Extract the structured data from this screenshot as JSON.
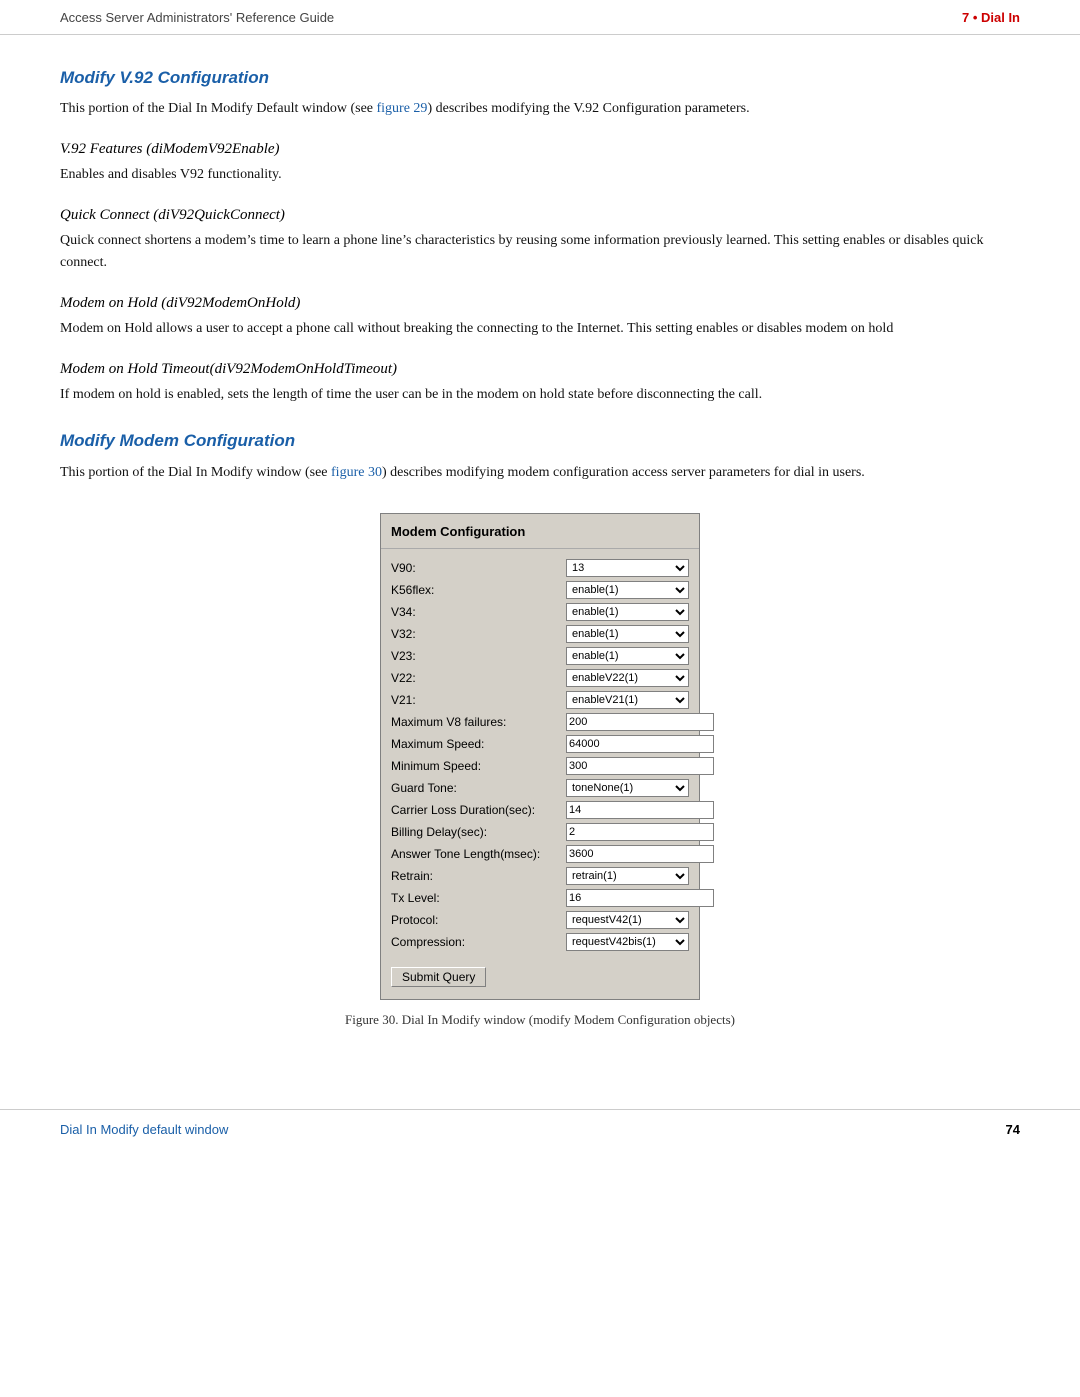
{
  "header": {
    "left": "Access Server Administrators' Reference Guide",
    "right": "7 • Dial In"
  },
  "sections": [
    {
      "id": "v92-config",
      "heading": "Modify V.92 Configuration",
      "intro": "This portion of the Dial In Modify Default window (see figure 29) describes modifying the V.92 Configuration parameters.",
      "intro_link": "figure 29",
      "subsections": [
        {
          "id": "v92-features",
          "title": "V.92 Features (diModemV92Enable)",
          "body": "Enables and disables V92 functionality."
        },
        {
          "id": "quick-connect",
          "title": "Quick Connect (diV92QuickConnect)",
          "body": "Quick connect shortens a modem’s time to learn a phone line’s characteristics by reusing some information previously learned. This setting enables or disables quick connect."
        },
        {
          "id": "modem-on-hold",
          "title": "Modem on Hold (diV92ModemOnHold)",
          "body": "Modem on Hold allows a user to accept a phone call without breaking the connecting to the Internet. This setting enables or disables modem on hold"
        },
        {
          "id": "modem-on-hold-timeout",
          "title": "Modem on Hold Timeout(diV92ModemOnHoldTimeout)",
          "body": "If modem on hold is enabled, sets the length of time the user can be in the modem on hold state before disconnecting the call."
        }
      ]
    },
    {
      "id": "modify-modem-config",
      "heading": "Modify Modem Configuration",
      "intro": "This portion of the Dial In Modify window (see figure 30) describes modifying modem configuration access server parameters for dial in users.",
      "intro_link": "figure 30"
    }
  ],
  "dialog": {
    "title": "Modem Configuration",
    "fields": [
      {
        "label": "V90:",
        "type": "select",
        "value": "13",
        "options": [
          "13"
        ]
      },
      {
        "label": "K56flex:",
        "type": "select",
        "value": "enable(1)",
        "options": [
          "enable(1)"
        ]
      },
      {
        "label": "V34:",
        "type": "select",
        "value": "enable(1)",
        "options": [
          "enable(1)"
        ]
      },
      {
        "label": "V32:",
        "type": "select",
        "value": "enable(1)",
        "options": [
          "enable(1)"
        ]
      },
      {
        "label": "V23:",
        "type": "select",
        "value": "enable(1)",
        "options": [
          "enable(1)"
        ]
      },
      {
        "label": "V22:",
        "type": "select",
        "value": "enableV22(1)",
        "options": [
          "enableV22(1)"
        ]
      },
      {
        "label": "V21:",
        "type": "select",
        "value": "enableV21(1)",
        "options": [
          "enableV21(1)"
        ]
      },
      {
        "label": "Maximum V8 failures:",
        "type": "input",
        "value": "200"
      },
      {
        "label": "Maximum Speed:",
        "type": "input",
        "value": "64000"
      },
      {
        "label": "Minimum Speed:",
        "type": "input",
        "value": "300"
      },
      {
        "label": "Guard Tone:",
        "type": "select",
        "value": "toneNone(1)",
        "options": [
          "toneNone(1)"
        ]
      },
      {
        "label": "Carrier Loss Duration(sec):",
        "type": "input",
        "value": "14"
      },
      {
        "label": "Billing Delay(sec):",
        "type": "input",
        "value": "2"
      },
      {
        "label": "Answer Tone Length(msec):",
        "type": "input",
        "value": "3600"
      },
      {
        "label": "Retrain:",
        "type": "select",
        "value": "retrain(1)",
        "options": [
          "retrain(1)"
        ]
      },
      {
        "label": "Tx Level:",
        "type": "input",
        "value": "16"
      },
      {
        "label": "Protocol:",
        "type": "select",
        "value": "requestV42(1)",
        "options": [
          "requestV42(1)"
        ]
      },
      {
        "label": "Compression:",
        "type": "select",
        "value": "requestV42bis(1)",
        "options": [
          "requestV42bis(1)"
        ]
      }
    ],
    "submit_button": "Submit Query"
  },
  "figure_caption": "Figure 30. Dial In Modify window (modify Modem Configuration objects)",
  "footer": {
    "left": "Dial In Modify default window",
    "right": "74"
  }
}
